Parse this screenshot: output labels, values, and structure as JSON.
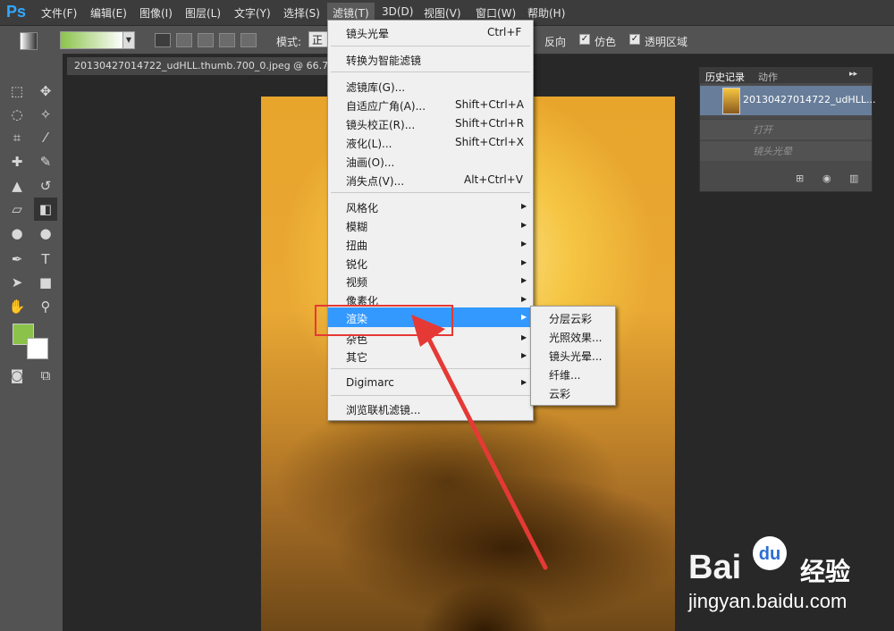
{
  "app": {
    "logo": "Ps"
  },
  "menubar": [
    {
      "label": "文件(F)"
    },
    {
      "label": "编辑(E)"
    },
    {
      "label": "图像(I)"
    },
    {
      "label": "图层(L)"
    },
    {
      "label": "文字(Y)"
    },
    {
      "label": "选择(S)"
    },
    {
      "label": "滤镜(T)"
    },
    {
      "label": "3D(D)"
    },
    {
      "label": "视图(V)"
    },
    {
      "label": "窗口(W)"
    },
    {
      "label": "帮助(H)"
    }
  ],
  "options": {
    "mode_label": "模式:",
    "mode_value": "正",
    "reverse": "反向",
    "dither": "仿色",
    "transparency": "透明区域",
    "checked": "✓"
  },
  "document": {
    "tab_title": "20130427014722_udHLL.thumb.700_0.jpeg @ 66.7%"
  },
  "filter_menu": {
    "last_filter": "镜头光晕",
    "last_filter_shortcut": "Ctrl+F",
    "smart": "转换为智能滤镜",
    "gallery": "滤镜库(G)...",
    "wide_angle": "自适应广角(A)...",
    "wide_angle_shortcut": "Shift+Ctrl+A",
    "lens_correct": "镜头校正(R)...",
    "lens_correct_shortcut": "Shift+Ctrl+R",
    "liquify": "液化(L)...",
    "liquify_shortcut": "Shift+Ctrl+X",
    "oil": "油画(O)...",
    "vanish": "消失点(V)...",
    "vanish_shortcut": "Alt+Ctrl+V",
    "stylize": "风格化",
    "blur": "模糊",
    "distort": "扭曲",
    "sharpen": "锐化",
    "video": "视频",
    "pixelate": "像素化",
    "render": "渲染",
    "sketch": "杂色",
    "other": "其它",
    "digimarc": "Digimarc",
    "browse": "浏览联机滤镜..."
  },
  "render_submenu": [
    "分层云彩",
    "光照效果...",
    "镜头光晕...",
    "纤维...",
    "云彩"
  ],
  "history_panel": {
    "tab_history": "历史记录",
    "tab_actions": "动作",
    "collapse": "▸▸",
    "snapshot_name": "20130427014722_udHLL...",
    "steps": [
      "打开",
      "镜头光晕"
    ]
  },
  "watermark": {
    "brand": "Bai",
    "paw": "du",
    "jy": "经验",
    "url": "jingyan.baidu.com"
  },
  "colors": {
    "highlight": "#3399ff",
    "annotation": "#e53935",
    "foreground": "#8bc34a",
    "background": "#ffffff"
  }
}
